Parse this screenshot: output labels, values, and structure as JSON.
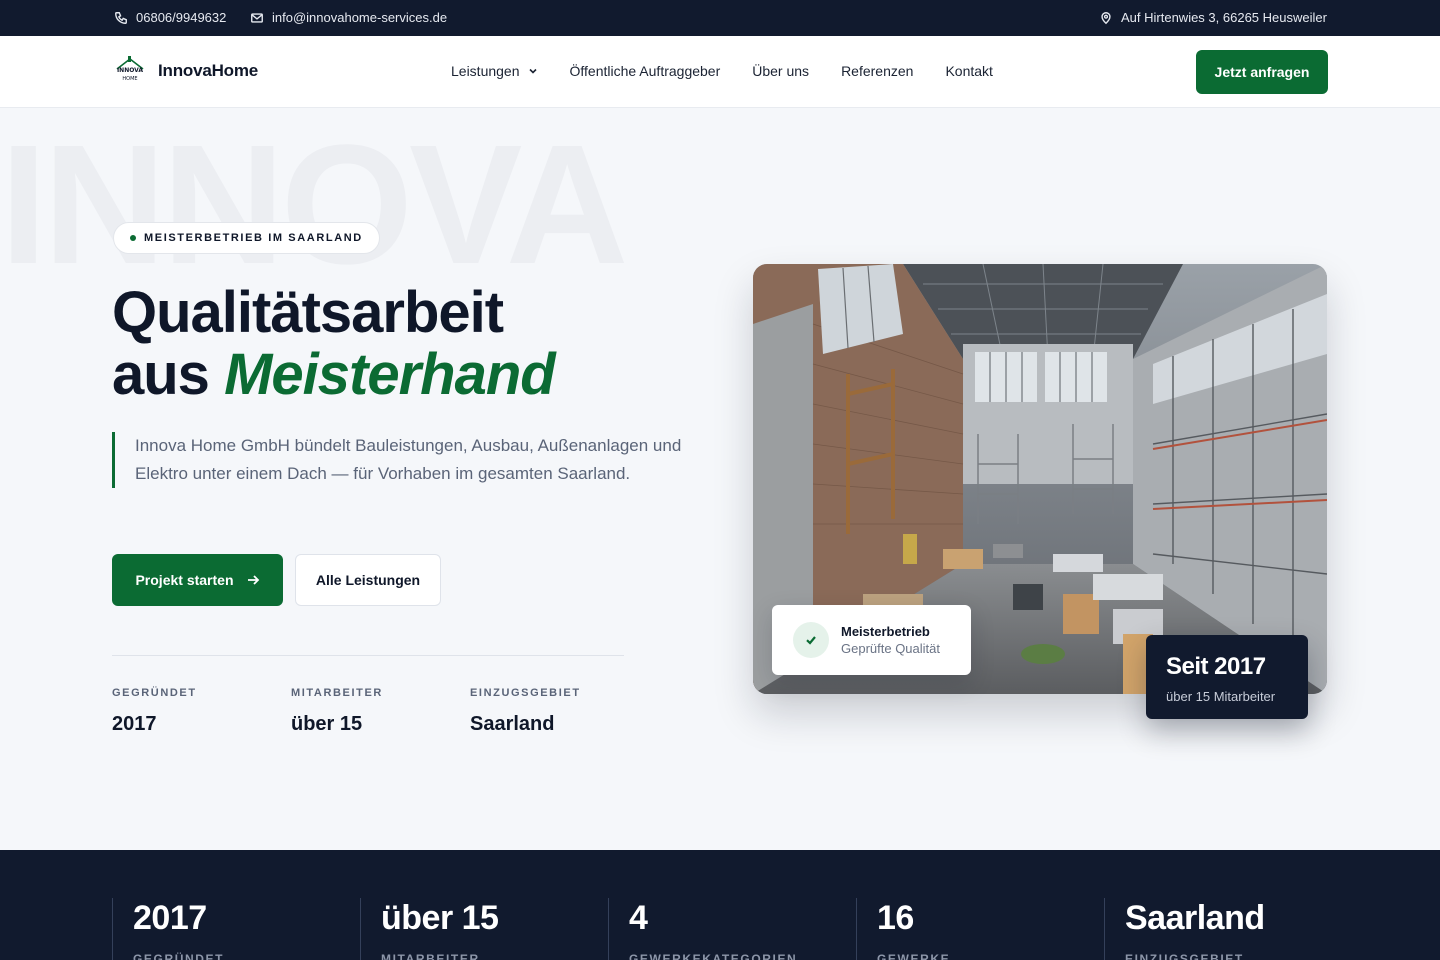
{
  "topbar": {
    "phone": "06806/9949632",
    "email": "info@innovahome-services.de",
    "address": "Auf Hirtenwies 3, 66265 Heusweiler"
  },
  "header": {
    "logo_mark": "INNOVA HOME",
    "brand": "InnovaHome",
    "nav": [
      {
        "label": "Leistungen",
        "has_dropdown": true
      },
      {
        "label": "Öffentliche Auftraggeber"
      },
      {
        "label": "Über uns"
      },
      {
        "label": "Referenzen"
      },
      {
        "label": "Kontakt"
      }
    ],
    "cta": "Jetzt anfragen"
  },
  "hero": {
    "watermark": "INNOVA",
    "badge": "MEISTERBETRIEB IM SAARLAND",
    "headline_line1": "Qualitätsarbeit",
    "headline_line2_prefix": "aus",
    "headline_line2_accent": "Meisterhand",
    "lead": "Innova Home GmbH bündelt Bauleistungen, Ausbau, Außenanlagen und Elektro unter einem Dach — für Vorhaben im gesamten Saarland.",
    "primary_button": "Projekt starten",
    "secondary_button": "Alle Leistungen",
    "stats": [
      {
        "label": "GEGRÜNDET",
        "value": "2017"
      },
      {
        "label": "MITARBEITER",
        "value": "über 15"
      },
      {
        "label": "EINZUGSGEBIET",
        "value": "Saarland"
      }
    ],
    "check_card": {
      "title": "Meisterbetrieb",
      "subtitle": "Geprüfte Qualität"
    },
    "since_card": {
      "title": "Seit 2017",
      "subtitle": "über 15 Mitarbeiter"
    }
  },
  "band": [
    {
      "value": "2017",
      "label": "GEGRÜNDET"
    },
    {
      "value": "über 15",
      "label": "MITARBEITER"
    },
    {
      "value": "4",
      "label": "GEWERKEKATEGORIEN"
    },
    {
      "value": "16",
      "label": "GEWERKE"
    },
    {
      "value": "Saarland",
      "label": "EINZUGSGEBIET"
    }
  ],
  "colors": {
    "brand_green": "#0b6b33",
    "navy": "#111a2e",
    "background": "#f5f7fa"
  }
}
